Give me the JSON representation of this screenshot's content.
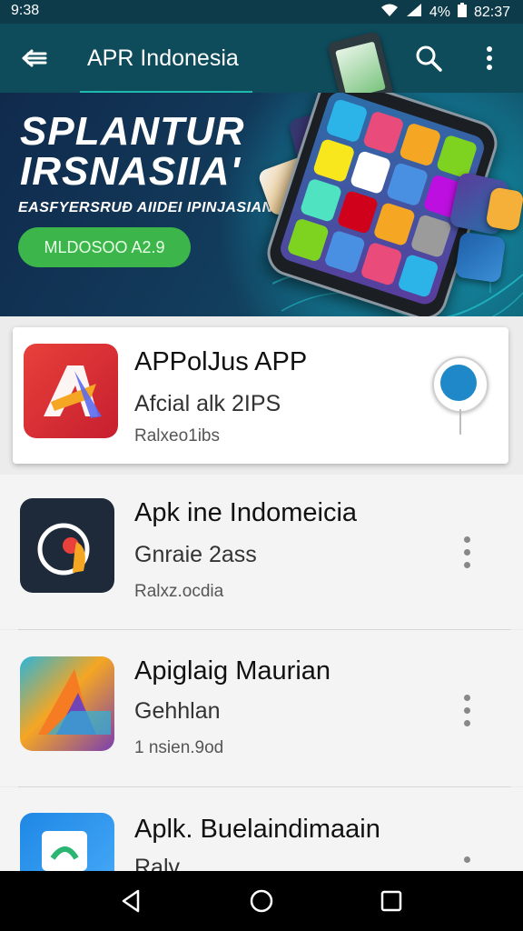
{
  "status_bar": {
    "time": "9:38",
    "battery_text": "4%",
    "right_time": "82:37"
  },
  "app_bar": {
    "title": "APR Indonesia"
  },
  "banner": {
    "line1": "SPLANTUR",
    "line2": "IRSNASIIA'",
    "tagline": "EASFYERSRUĐ AIIDEI IPINJASIAN",
    "cta": "MLDOSOO A2.9"
  },
  "featured": {
    "name": "APPolJus APP",
    "subtitle": "Afcial alk 2IPS",
    "meta": "Ralxeo1ibs"
  },
  "apps": [
    {
      "name": "Apk ine  Indomeicia",
      "subtitle": "Gnraie 2ass",
      "meta": "Ralxz.ocdia"
    },
    {
      "name": "Apiglaig Maurian",
      "subtitle": "Gehhlan",
      "meta": "1 nsien.9od"
    },
    {
      "name": "Aplk. Buelaindimaain",
      "subtitle": "Ralv",
      "meta": ""
    }
  ],
  "colors": {
    "status_bar": "#0d3b4a",
    "app_bar": "#0e4c5c",
    "cta_green": "#3cb64a",
    "pin_blue": "#1e88c8"
  },
  "icons": {
    "back": "arrow-left-icon",
    "search": "search-icon",
    "more": "more-vert-icon",
    "nav_back": "triangle-back-icon",
    "nav_home": "circle-home-icon",
    "nav_recents": "square-recents-icon"
  }
}
